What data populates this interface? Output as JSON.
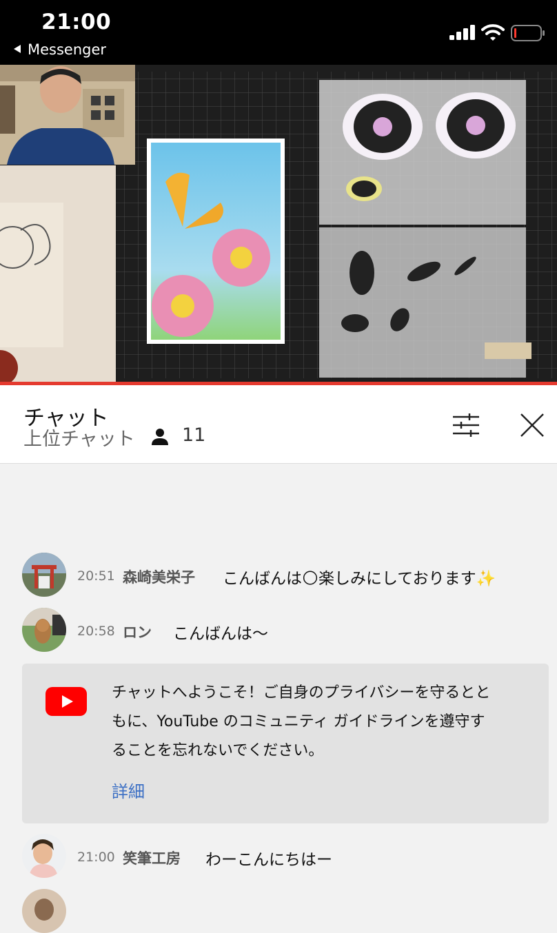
{
  "status_bar": {
    "time": "21:00",
    "back_app": "Messenger"
  },
  "chat": {
    "title": "チャット",
    "mode": "上位チャット",
    "viewer_count": "11"
  },
  "messages": [
    {
      "time": "20:51",
      "author": "森崎美栄子",
      "text": "こんばんは🌕楽しみにしております✨"
    },
    {
      "time": "20:58",
      "author": "ロン",
      "text": "こんばんは〜"
    },
    {
      "time": "21:00",
      "author": "笑筆工房",
      "text": "わーこんにちはー"
    }
  ],
  "welcome": {
    "line1": "チャットへようこそ！ご自身のプライバシーを守るとと",
    "line2": "もに、YouTube のコミュニティ ガイドラインを遵守す",
    "line3": "ることを忘れないでください。",
    "link": "詳細"
  },
  "colors": {
    "progress": "#e53a2f",
    "link": "#3b6fc4",
    "yt_red": "#ff0000"
  }
}
